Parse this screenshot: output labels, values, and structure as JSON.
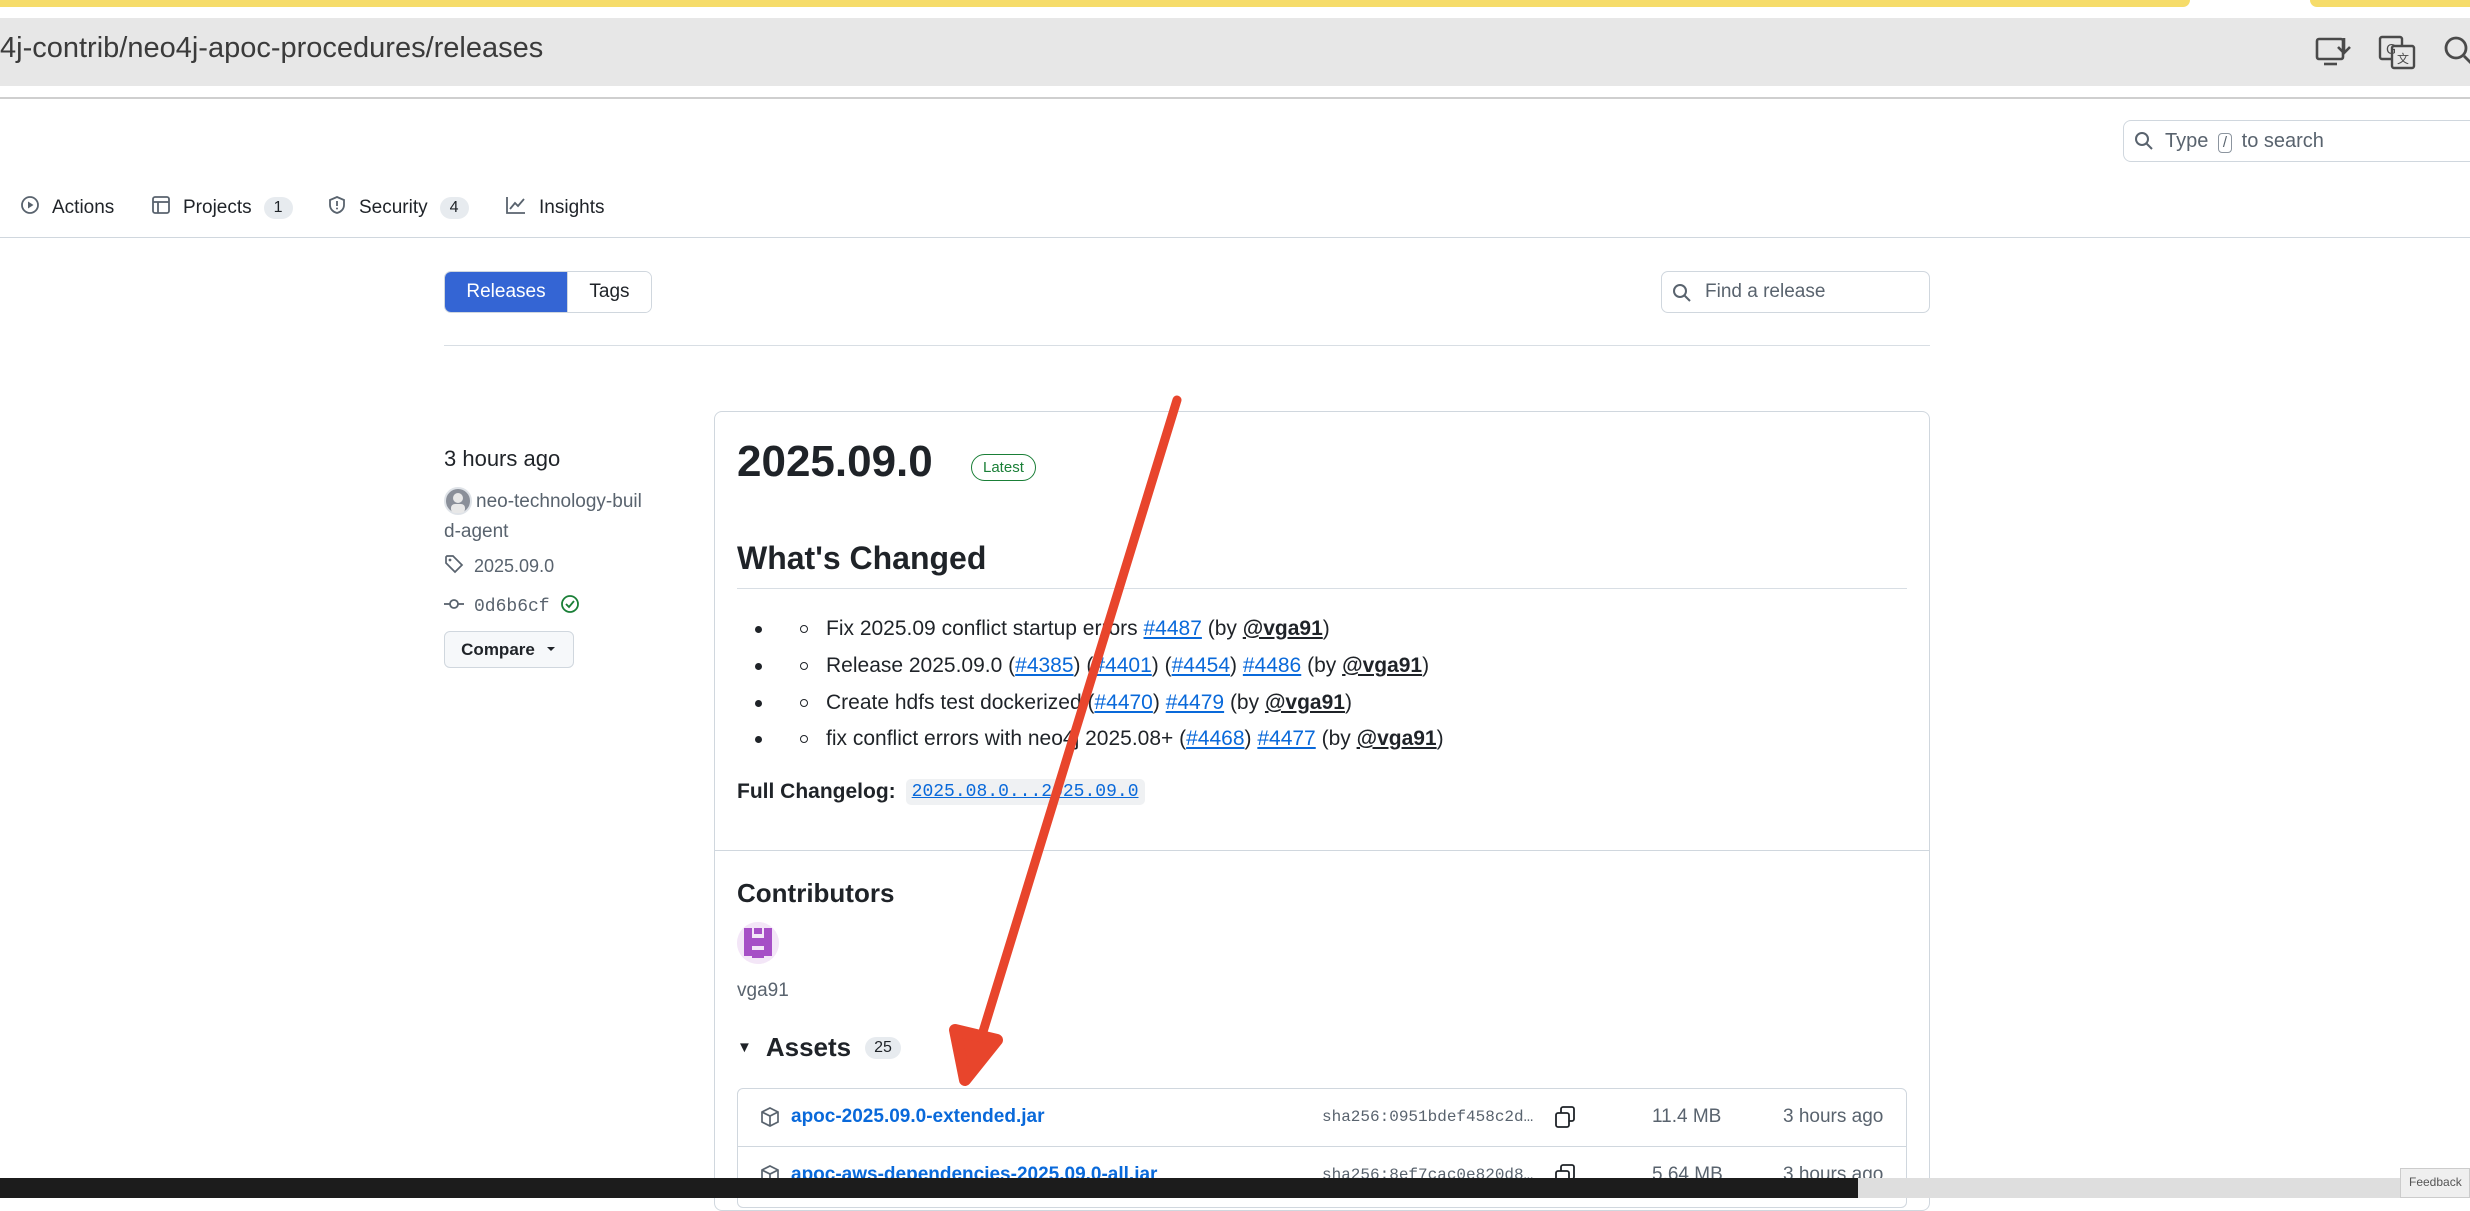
{
  "browser": {
    "url": "4j-contrib/neo4j-apoc-procedures/releases",
    "icons": [
      "install-app-icon",
      "translate-icon",
      "zoom-icon"
    ]
  },
  "header": {
    "search_prefix": "Type",
    "search_key": "/",
    "search_suffix": "to search"
  },
  "repo_nav": [
    {
      "label": "Actions",
      "icon": "play-circle-icon"
    },
    {
      "label": "Projects",
      "icon": "table-icon",
      "count": "1"
    },
    {
      "label": "Security",
      "icon": "shield-icon",
      "count": "4"
    },
    {
      "label": "Insights",
      "icon": "graph-icon"
    }
  ],
  "filters": {
    "releases_label": "Releases",
    "tags_label": "Tags",
    "find_placeholder": "Find a release"
  },
  "release": {
    "time": "3 hours ago",
    "author": "neo-technology-build-agent",
    "author_line1": "neo-technology-buil",
    "author_line2": "d-agent",
    "tag": "2025.09.0",
    "commit": "0d6b6cf",
    "compare_label": "Compare",
    "title": "2025.09.0",
    "badge": "Latest",
    "whats_changed": "What's Changed",
    "changes": [
      {
        "text": "Fix 2025.09 conflict startup errors",
        "links": [
          "#4487"
        ],
        "mention": "@vga91"
      },
      {
        "text": "Release 2025.09.0",
        "links": [
          "#4385",
          "#4401",
          "#4454",
          "#4486"
        ],
        "mention": "@vga91"
      },
      {
        "text": "Create hdfs test dockerized",
        "links": [
          "#4470",
          "#4479"
        ],
        "mention": "@vga91"
      },
      {
        "text": "fix conflict errors with neo4j 2025.08+",
        "links": [
          "#4468",
          "#4477"
        ],
        "mention": "@vga91"
      }
    ],
    "changelog_label": "Full Changelog:",
    "changelog_link": "2025.08.0...2025.09.0",
    "contributors_title": "Contributors",
    "contributor": "vga91",
    "assets_title": "Assets",
    "assets_count": "25",
    "assets": [
      {
        "name": "apoc-2025.09.0-extended.jar",
        "sha": "sha256:0951bdef458c2d…",
        "size": "11.4 MB",
        "date": "3 hours ago"
      },
      {
        "name": "apoc-aws-dependencies-2025.09.0-all.jar",
        "sha": "sha256:8ef7cac0e820d8…",
        "size": "5.64 MB",
        "date": "3 hours ago"
      }
    ]
  },
  "colors": {
    "accent": "#3465d4",
    "link": "#0969da",
    "latest_badge": "#1a7f37",
    "arrow": "#e8452c"
  },
  "feedback_label": "Feedback"
}
